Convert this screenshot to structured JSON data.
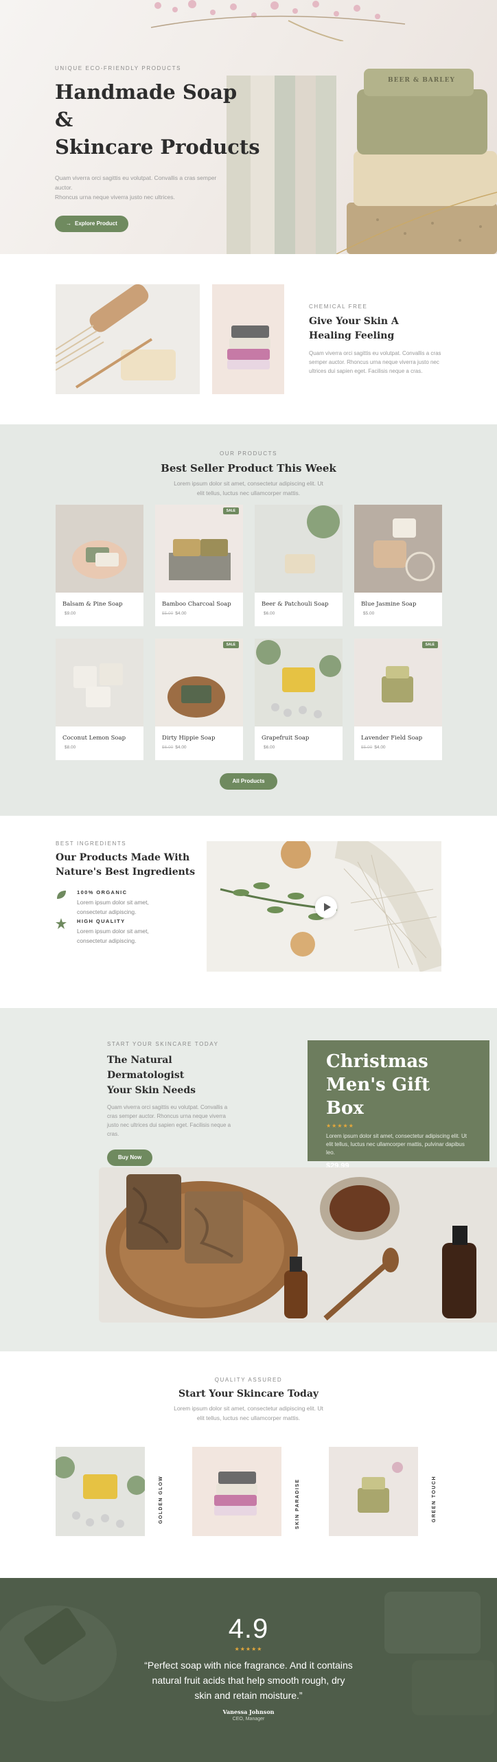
{
  "hero": {
    "kicker": "UNIQUE ECO-FRIENDLY PRODUCTS",
    "title_line1": "Handmade Soap &",
    "title_line2": "Skincare Products",
    "body_line1": "Quam viverra orci sagittis eu volutpat. Convallis a cras semper auctor.",
    "body_line2": "Rhoncus urna neque viverra justo nec ultrices.",
    "button_label": "Explore Product",
    "soap_stamp": "BEER & BARLEY"
  },
  "chemical": {
    "kicker": "CHEMICAL FREE",
    "title_line1": "Give Your Skin A",
    "title_line2": "Healing Feeling",
    "body": "Quam viverra orci sagittis eu volutpat. Convallis a cras semper auctor. Rhoncus urna neque viverra justo nec ultrices dui sapien eget. Facilisis neque a cras."
  },
  "best_seller": {
    "kicker": "OUR PRODUCTS",
    "title": "Best Seller Product This Week",
    "body_line1": "Lorem ipsum dolor sit amet, consectetur adipiscing elit. Ut",
    "body_line2": "elit tellus, luctus nec ullamcorper mattis.",
    "sale_label": "SALE",
    "products": [
      {
        "name": "Balsam & Pine Soap",
        "price": "$9.00",
        "old_price": ""
      },
      {
        "name": "Bamboo Charcoal Soap",
        "price": "$4.00",
        "old_price": "$5.00"
      },
      {
        "name": "Beer & Patchouli Soap",
        "price": "$6.00",
        "old_price": ""
      },
      {
        "name": "Blue Jasmine Soap",
        "price": "$5.00",
        "old_price": ""
      },
      {
        "name": "Coconut Lemon Soap",
        "price": "$8.00",
        "old_price": ""
      },
      {
        "name": "Dirty Hippie Soap",
        "price": "$4.00",
        "old_price": "$6.00"
      },
      {
        "name": "Grapefruit Soap",
        "price": "$6.00",
        "old_price": ""
      },
      {
        "name": "Lavender Field Soap",
        "price": "$4.00",
        "old_price": "$5.00"
      }
    ],
    "button_label": "All Products"
  },
  "ingredients": {
    "kicker": "BEST INGREDIENTS",
    "title_line1": "Our Products Made With",
    "title_line2": "Nature's Best Ingredients",
    "features": [
      {
        "title": "100% ORGANIC",
        "body_line1": "Lorem ipsum dolor sit amet,",
        "body_line2": "consectetur adipiscing.",
        "icon": "leaf-icon"
      },
      {
        "title": "HIGH QUALITY",
        "body_line1": "Lorem ipsum dolor sit amet,",
        "body_line2": "consectetur adipiscing.",
        "icon": "star-icon"
      }
    ]
  },
  "promo": {
    "kicker": "START YOUR SKINCARE TODAY",
    "title_line1": "The Natural",
    "title_line2": "Dermatologist",
    "title_line3": "Your Skin Needs",
    "body": "Quam viverra orci sagittis eu volutpat. Convallis a cras semper auctor. Rhoncus urna neque viverra justo nec ultrices dui sapien eget. Facilisis neque a cras.",
    "button_label": "Buy Now",
    "offer": {
      "title_line1": "Christmas",
      "title_line2": "Men's Gift Box",
      "stars": "★★★★★",
      "body": "Lorem ipsum dolor sit amet, consectetur adipiscing elit. Ut elit tellus, luctus nec ullamcorper mattis, pulvinar dapibus leo.",
      "price": "$29.99"
    }
  },
  "skincare": {
    "kicker": "QUALITY ASSURED",
    "title": "Start Your Skincare Today",
    "body_line1": "Lorem ipsum dolor sit amet, consectetur adipiscing elit. Ut",
    "body_line2": "elit tellus, luctus nec ullamcorper mattis.",
    "items": [
      {
        "label": "GOLDEN GLOW"
      },
      {
        "label": "SKIN PARADISE"
      },
      {
        "label": "GREEN TOUCH"
      }
    ]
  },
  "testimonial": {
    "rating": "4.9",
    "stars": "★★★★★",
    "quote_line1": "“Perfect soap with nice fragrance. And it contains",
    "quote_line2": "natural fruit acids that help smooth rough, dry",
    "quote_line3": "skin and retain moisture.”",
    "author": "Vanessa Johnson",
    "role": "CEO, Manager"
  },
  "colors": {
    "accent": "#6f8a5f",
    "gift_box": "#6d7d5e",
    "testimonial_bg": "#4d5b48",
    "star": "#e5a83b"
  }
}
